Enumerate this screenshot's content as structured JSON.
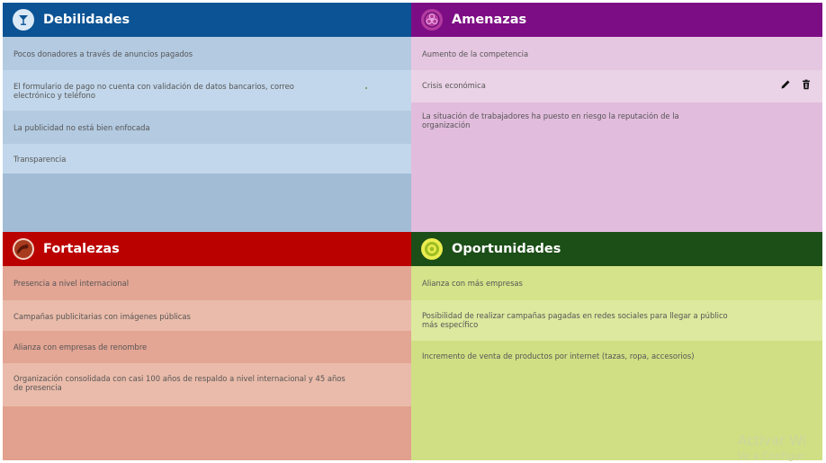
{
  "quadrants": {
    "debilidades": {
      "title": "Debilidades",
      "header_color": "#0b5394",
      "icon": "cocktail-glass-icon",
      "items": [
        "Pocos donadores a través de anuncios pagados",
        "El formulario de pago no cuenta con validación de datos bancarios, correo electrónico y teléfono",
        "La publicidad no está bien enfocada",
        "Transparencia"
      ]
    },
    "amenazas": {
      "title": "Amenazas",
      "header_color": "#7d0d84",
      "icon": "biohazard-icon",
      "items": [
        "Aumento de la competencia",
        "Crisis económica",
        "La situación de trabajadores ha puesto en riesgo la reputación de la organización"
      ]
    },
    "fortalezas": {
      "title": "Fortalezas",
      "header_color": "#bb0000",
      "icon": "flexed-arm-icon",
      "items": [
        "Presencia a nivel internacional",
        "Campañas publicitarias con imágenes públicas",
        "Alianza con empresas de renombre",
        "Organización consolidada con casi 100 años de respaldo a nivel internacional y 45 años de presencia"
      ]
    },
    "oportunidades": {
      "title": "Oportunidades",
      "header_color": "#1c4e18",
      "icon": "target-icon",
      "items": [
        "Alianza con más empresas",
        "Posibilidad de realizar campañas pagadas en redes sociales para llegar a público más específico",
        "Incremento de venta de productos por internet (tazas, ropa, accesorios)"
      ]
    }
  },
  "row_actions": [
    "edit-icon",
    "delete-icon"
  ],
  "watermark": {
    "line1": "Activar Wi",
    "line2": "Ve a Configur"
  }
}
